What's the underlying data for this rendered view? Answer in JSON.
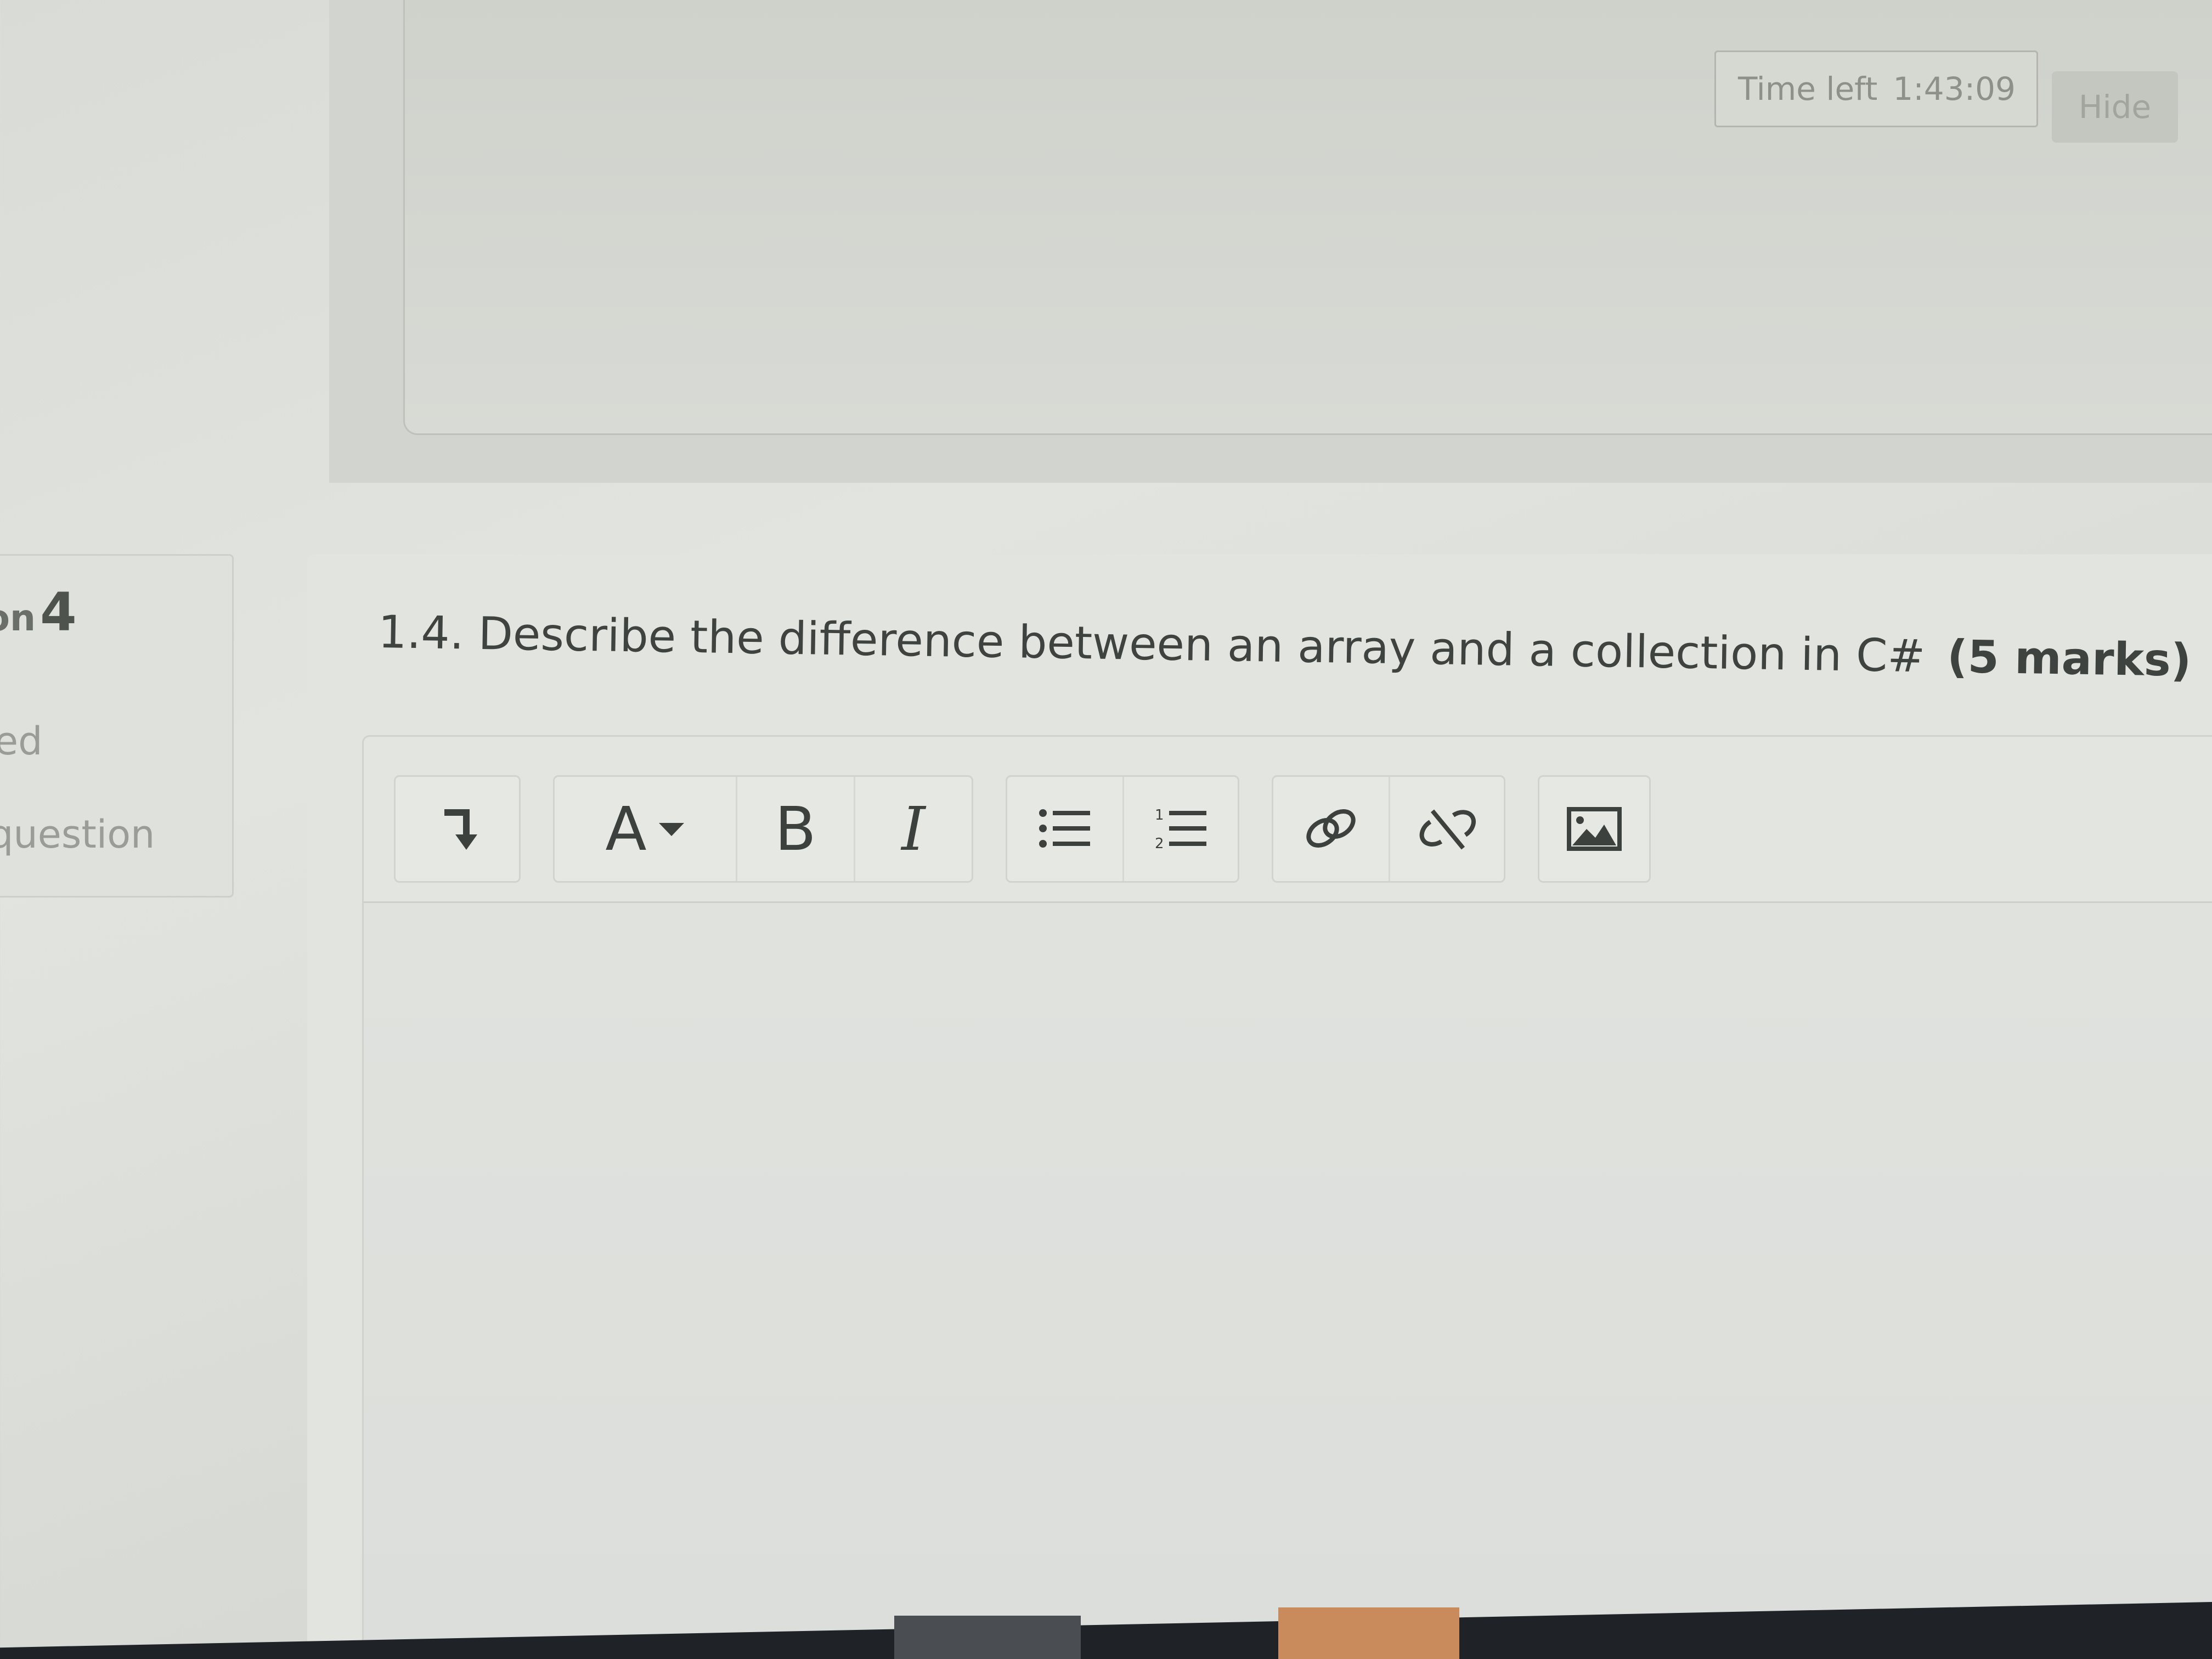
{
  "timer": {
    "label": "Time left",
    "value": "1:43:09",
    "hide_label": "Hide"
  },
  "question_info": {
    "title_prefix": "ion",
    "number": "4",
    "status": "ed",
    "flag_text": "question"
  },
  "question": {
    "text": "1.4. Describe the difference between an array and a collection in C#",
    "marks": "(5 marks)"
  },
  "toolbar": {
    "buttons": [
      {
        "name": "show-more-buttons",
        "icon": "expand-down-icon"
      },
      {
        "name": "paragraph-styles",
        "label": "A",
        "icon": "caret-down-icon"
      },
      {
        "name": "bold",
        "label": "B"
      },
      {
        "name": "italic",
        "label": "I"
      },
      {
        "name": "unordered-list",
        "icon": "bullet-list-icon"
      },
      {
        "name": "ordered-list",
        "icon": "numbered-list-icon"
      },
      {
        "name": "link",
        "icon": "link-icon"
      },
      {
        "name": "unlink",
        "icon": "unlink-icon"
      },
      {
        "name": "insert-image",
        "icon": "image-icon"
      }
    ]
  },
  "colors": {
    "text": "#3f433f",
    "toolbar_bg": "#e3e5e1",
    "page_bg": "#dcdedb"
  }
}
